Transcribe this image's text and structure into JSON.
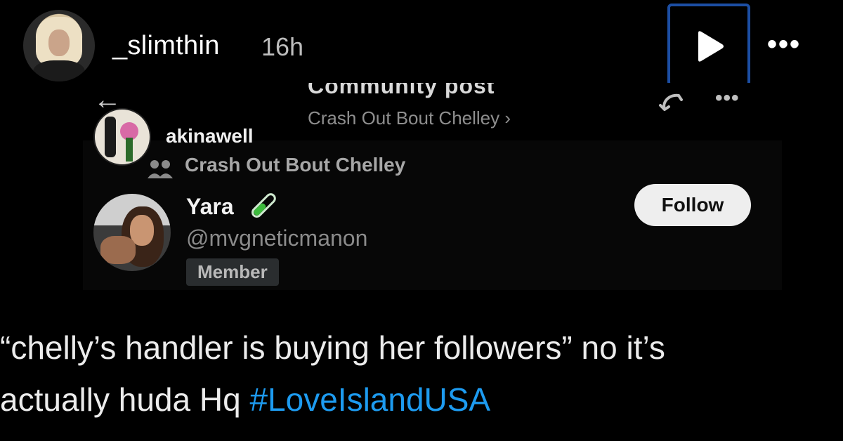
{
  "story": {
    "username": "_slimthin",
    "time": "16h"
  },
  "embed": {
    "title_partial": "Community post",
    "community_link": "Crash Out Bout Chelley ›",
    "reposter": "akinawell",
    "group": "Crash Out Bout Chelley",
    "author": {
      "name": "Yara",
      "handle": "@mvgneticmanon",
      "badge": "Member"
    },
    "follow_label": "Follow"
  },
  "caption": {
    "line1": "“chelly’s handler is buying her followers” no it’s",
    "line2": "actually huda Hq ",
    "hashtag": "#LoveIslandUSA"
  },
  "colors": {
    "hashtag": "#1d9bf0",
    "highlight_border": "#1c4ea3"
  }
}
